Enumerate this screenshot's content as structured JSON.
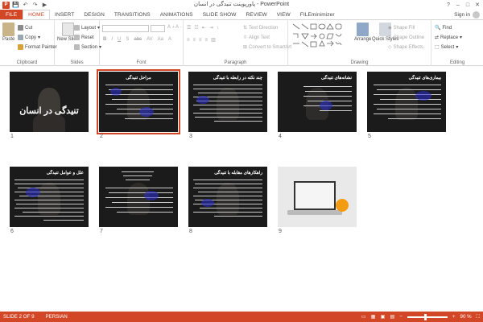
{
  "titlebar": {
    "title": "پاورپوینت تنیدگی در انسان - PowerPoint",
    "app_icon_letter": "P",
    "qat": [
      "save-icon",
      "undo-icon",
      "redo-icon",
      "start-from-beginning-icon"
    ],
    "window_buttons": [
      "?",
      "–",
      "□",
      "✕"
    ]
  },
  "tabs": {
    "file": "FILE",
    "items": [
      "HOME",
      "INSERT",
      "DESIGN",
      "TRANSITIONS",
      "ANIMATIONS",
      "SLIDE SHOW",
      "REVIEW",
      "VIEW",
      "FILEminimizer"
    ],
    "active": "HOME",
    "signin": "Sign in"
  },
  "ribbon": {
    "clipboard": {
      "label": "Clipboard",
      "paste": "Paste",
      "cut": "Cut",
      "copy": "Copy",
      "format_painter": "Format Painter"
    },
    "slides": {
      "label": "Slides",
      "new_slide": "New Slide",
      "layout": "Layout",
      "reset": "Reset",
      "section": "Section"
    },
    "font": {
      "label": "Font",
      "font_size": "",
      "font_name": ""
    },
    "paragraph": {
      "label": "Paragraph",
      "text_direction": "Text Direction",
      "align_text": "Align Text",
      "convert_smartart": "Convert to SmartArt"
    },
    "drawing": {
      "label": "Drawing",
      "arrange": "Arrange",
      "quick_styles": "Quick Styles",
      "shape_fill": "Shape Fill",
      "shape_outline": "Shape Outline",
      "shape_effects": "Shape Effects"
    },
    "editing": {
      "label": "Editing",
      "find": "Find",
      "replace": "Replace",
      "select": "Select"
    }
  },
  "slides": [
    {
      "num": "1",
      "title": "تنیدگی در انسان",
      "kind": "cover"
    },
    {
      "num": "2",
      "title": "مراحل تنیدگی",
      "kind": "text",
      "selected": true
    },
    {
      "num": "3",
      "title": "چند نکته در رابطه با تنیدگی",
      "kind": "text"
    },
    {
      "num": "4",
      "title": "نشانه‌های تنیدگی",
      "kind": "text"
    },
    {
      "num": "5",
      "title": "بیماری‌های تنیدگی",
      "kind": "text"
    },
    {
      "num": "6",
      "title": "علل و عوامل تنیدگی",
      "kind": "text"
    },
    {
      "num": "7",
      "title": "",
      "kind": "text"
    },
    {
      "num": "8",
      "title": "راهکارهای مقابله با تنیدگی",
      "kind": "text"
    },
    {
      "num": "9",
      "title": "",
      "kind": "image"
    }
  ],
  "statusbar": {
    "slide_info": "SLIDE 2 OF 9",
    "language": "PERSIAN",
    "zoom": "90 %",
    "zoom_level": 0.45
  },
  "colors": {
    "accent": "#d24726"
  }
}
